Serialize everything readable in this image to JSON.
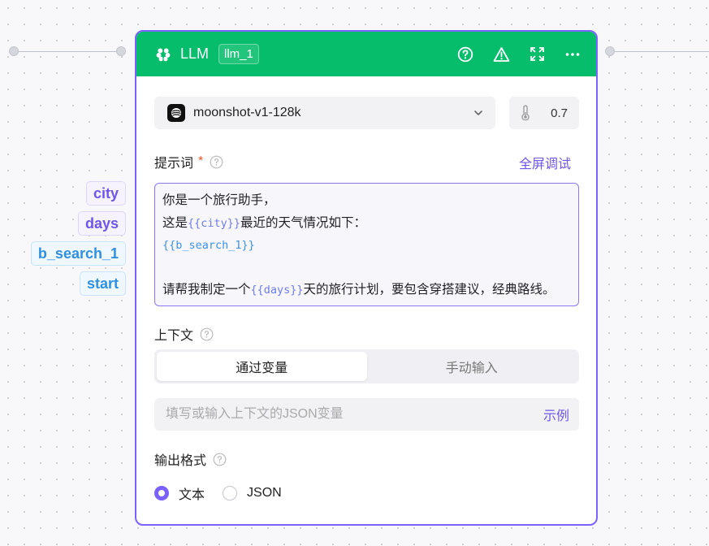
{
  "canvas": {
    "input_variables": [
      {
        "label": "city",
        "color": "purple"
      },
      {
        "label": "days",
        "color": "purple"
      },
      {
        "label": "b_search_1",
        "color": "blue"
      },
      {
        "label": "start",
        "color": "blue"
      }
    ]
  },
  "node": {
    "title": "LLM",
    "id_tag": "llm_1",
    "header_color": "#05bd6a",
    "accent_color": "#7b61ff",
    "actions": [
      "help-icon",
      "warning-icon",
      "expand-icon",
      "more-icon"
    ]
  },
  "model": {
    "name": "moonshot-v1-128k",
    "temperature": "0.7"
  },
  "prompt": {
    "label": "提示词",
    "required_mark": "*",
    "fullscreen_debug": "全屏调试",
    "lines": [
      [
        {
          "text": "你是一个旅行助手，",
          "var": false
        }
      ],
      [
        {
          "text": "这是",
          "var": false
        },
        {
          "text": "{{city}}",
          "var": true
        },
        {
          "text": "最近的天气情况如下：",
          "var": false
        }
      ],
      [
        {
          "text": "{{b_search_1}}",
          "var": true
        }
      ],
      [],
      [
        {
          "text": "请帮我制定一个",
          "var": false
        },
        {
          "text": "{{days}}",
          "var": true
        },
        {
          "text": "天的旅行计划，要包含穿搭建议，经典路线。",
          "var": false
        }
      ]
    ]
  },
  "context": {
    "label": "上下文",
    "tabs": [
      {
        "label": "通过变量",
        "active": true
      },
      {
        "label": "手动输入",
        "active": false
      }
    ],
    "input_placeholder": "填写或输入上下文的JSON变量",
    "input_value": "",
    "example_link": "示例"
  },
  "output": {
    "label": "输出格式",
    "options": [
      {
        "label": "文本",
        "selected": true
      },
      {
        "label": "JSON",
        "selected": false
      }
    ]
  }
}
